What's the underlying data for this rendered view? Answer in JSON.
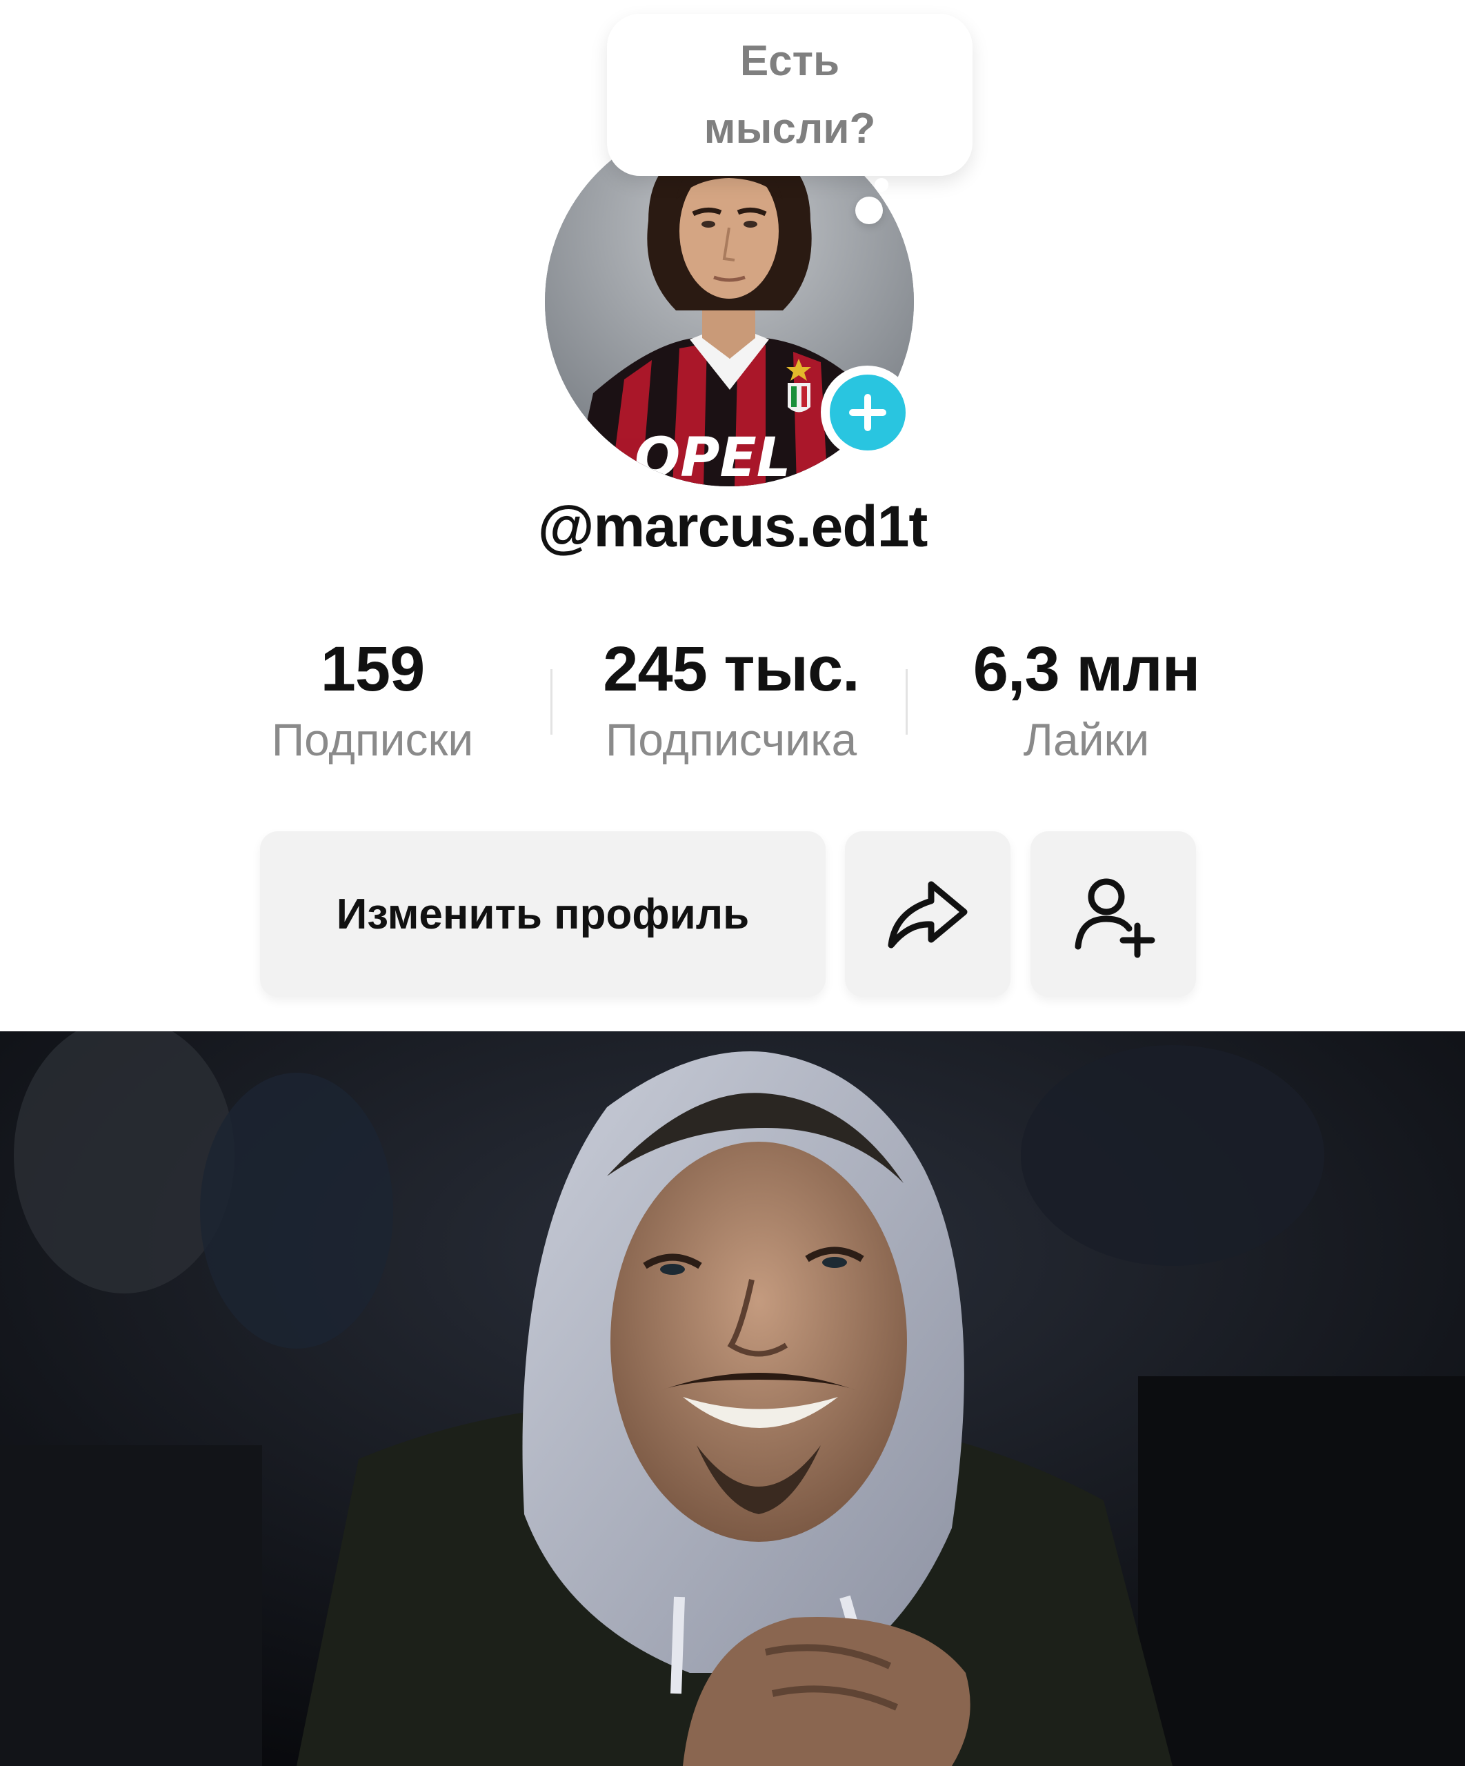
{
  "thought_bubble": {
    "line1": "Есть",
    "line2": "мысли?"
  },
  "avatar": {
    "icon": "profile-photo",
    "badge_icon": "plus-icon",
    "badge_color": "#29c5e0",
    "jersey_text": "OPEL"
  },
  "profile": {
    "username": "@marcus.ed1t"
  },
  "stats": {
    "following": {
      "value": "159",
      "label": "Подписки"
    },
    "followers": {
      "value": "245 тыс.",
      "label": "Подписчика"
    },
    "likes": {
      "value": "6,3 млн",
      "label": "Лайки"
    }
  },
  "actions": {
    "edit_profile": "Изменить профиль",
    "share_icon": "share-arrow-icon",
    "add_friend_icon": "add-person-icon"
  },
  "colors": {
    "background": "#ffffff",
    "text_primary": "#111111",
    "text_secondary": "#8a8a8a",
    "button_bg": "#f2f2f2",
    "accent": "#29c5e0"
  }
}
